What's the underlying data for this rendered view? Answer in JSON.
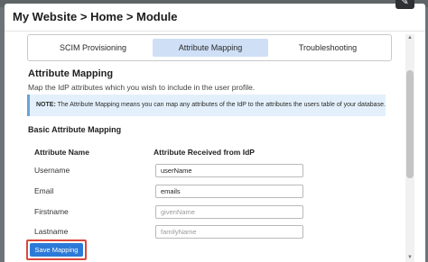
{
  "modal": {
    "title": "My Website > Home > Module",
    "close_glyph": "✎"
  },
  "tabs": [
    {
      "label": "SCIM Provisioning",
      "active": false
    },
    {
      "label": "Attribute Mapping",
      "active": true
    },
    {
      "label": "Troubleshooting",
      "active": false
    }
  ],
  "section": {
    "title": "Attribute Mapping",
    "description": "Map the IdP attributes which you wish to include in the user profile."
  },
  "note": {
    "prefix": "NOTE:",
    "text": " The Attribute Mapping means you can map any attributes of the IdP to the attributes the users table of your database."
  },
  "mapping": {
    "title": "Basic Attribute Mapping",
    "col_name": "Attribute Name",
    "col_received": "Attribute Received from IdP",
    "rows": [
      {
        "label": "Username",
        "value": "userName",
        "placeholder": ""
      },
      {
        "label": "Email",
        "value": "emails",
        "placeholder": ""
      },
      {
        "label": "Firstname",
        "value": "",
        "placeholder": "givenName"
      },
      {
        "label": "Lastname",
        "value": "",
        "placeholder": "familyName"
      }
    ]
  },
  "actions": {
    "save_label": "Save Mapping"
  },
  "colors": {
    "accent": "#2c7ad8",
    "active_tab": "#cfe0f6",
    "highlight_border": "#d9483b",
    "note_background": "#e3f0fb"
  },
  "icons": {
    "close": "edit-icon",
    "scroll_up": "triangle-up-icon",
    "scroll_down": "triangle-down-icon"
  }
}
